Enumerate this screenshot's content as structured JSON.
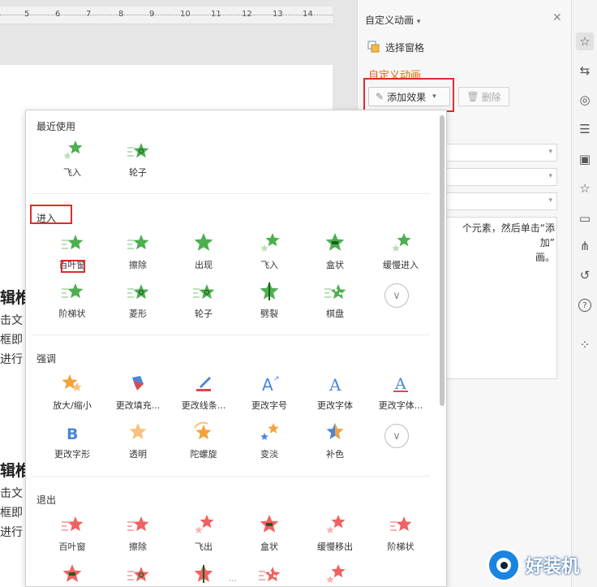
{
  "ruler": {
    "numbers": [
      "5",
      "6",
      "7",
      "8",
      "9",
      "10",
      "11",
      "12",
      "13",
      "14"
    ]
  },
  "document": {
    "heading_fragments": [
      "辑椎",
      "辑椎"
    ],
    "line_fragments": [
      "击文",
      "框即",
      "进行",
      "击文",
      "框即",
      "进行"
    ]
  },
  "pane": {
    "title": "自定义动画",
    "title_caret": "▾",
    "select_pane_label": "选择窗格",
    "section_label": "自定义动画",
    "add_effect_label": "添加效果",
    "delete_label": "删除",
    "hint_text": "个元素，然后单击“添加”\n画。"
  },
  "dropdown": {
    "groups": [
      {
        "title": "最近使用",
        "items": [
          {
            "label": "飞入",
            "icon": "fly-in-star-icon"
          },
          {
            "label": "轮子",
            "icon": "wheel-star-icon"
          }
        ]
      },
      {
        "title": "进入",
        "items": [
          {
            "label": "百叶窗",
            "icon": "blinds-star-icon"
          },
          {
            "label": "擦除",
            "icon": "wipe-star-icon"
          },
          {
            "label": "出现",
            "icon": "appear-star-icon"
          },
          {
            "label": "飞入",
            "icon": "fly-in-star-icon"
          },
          {
            "label": "盒状",
            "icon": "box-star-icon"
          },
          {
            "label": "缓慢进入",
            "icon": "crawl-in-star-icon"
          },
          {
            "label": "阶梯状",
            "icon": "stairs-star-icon"
          },
          {
            "label": "菱形",
            "icon": "diamond-star-icon"
          },
          {
            "label": "轮子",
            "icon": "wheel-star-icon"
          },
          {
            "label": "劈裂",
            "icon": "split-star-icon"
          },
          {
            "label": "棋盘",
            "icon": "checkerboard-star-icon"
          }
        ]
      },
      {
        "title": "强调",
        "items": [
          {
            "label": "放大/缩小",
            "icon": "grow-shrink-star-icon"
          },
          {
            "label": "更改填充...",
            "icon": "fill-bucket-icon"
          },
          {
            "label": "更改线条...",
            "icon": "pen-line-icon"
          },
          {
            "label": "更改字号",
            "icon": "font-size-a-icon"
          },
          {
            "label": "更改字体",
            "icon": "font-a-icon"
          },
          {
            "label": "更改字体...",
            "icon": "font-color-a-icon"
          },
          {
            "label": "更改字形",
            "icon": "bold-b-icon"
          },
          {
            "label": "透明",
            "icon": "transparent-star-icon"
          },
          {
            "label": "陀螺旋",
            "icon": "spin-star-icon"
          },
          {
            "label": "变淡",
            "icon": "fade-star-icon"
          },
          {
            "label": "补色",
            "icon": "complement-star-icon"
          }
        ]
      },
      {
        "title": "退出",
        "items": [
          {
            "label": "百叶窗",
            "icon": "blinds-star-icon"
          },
          {
            "label": "擦除",
            "icon": "wipe-star-icon"
          },
          {
            "label": "飞出",
            "icon": "fly-out-star-icon"
          },
          {
            "label": "盒状",
            "icon": "box-star-icon"
          },
          {
            "label": "缓慢移出",
            "icon": "crawl-out-star-icon"
          },
          {
            "label": "阶梯状",
            "icon": "stairs-star-icon"
          }
        ]
      }
    ],
    "more_glyph": "∨",
    "bottom_handle": "⋯"
  },
  "toolbar": {
    "icons": [
      "animation-star-icon",
      "switch-icon",
      "shapes-icon",
      "sliders-icon",
      "picture-icon",
      "star-icon",
      "archive-icon",
      "share-icon",
      "history-icon",
      "help-icon",
      "apps-icon"
    ]
  },
  "watermark": {
    "text": "好装机"
  },
  "colors": {
    "enter": "#4caf50",
    "emphasis_orange": "#f2a33a",
    "emphasis_blue": "#4a86d8",
    "exit": "#f06262",
    "highlight": "#e02b2b",
    "section_accent": "#e06b00"
  }
}
